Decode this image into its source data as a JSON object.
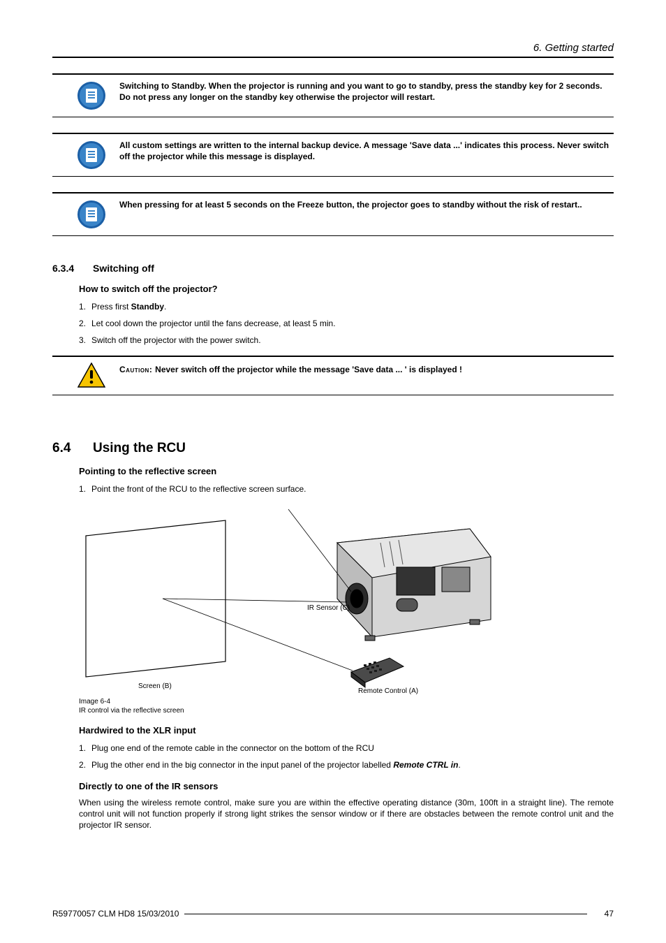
{
  "header": {
    "chapter_title": "6.  Getting started"
  },
  "notes": {
    "n1": "Switching to Standby.  When the projector is running and you want to go to standby, press the standby key for 2 seconds.  Do not press any longer on the standby key otherwise the projector will restart.",
    "n2": "All custom settings are written to the internal backup device.  A message 'Save data ...' indicates this process. Never switch off the projector while this message is displayed.",
    "n3": "When pressing for at least 5 seconds on the Freeze button, the projector goes to standby without the risk of restart.."
  },
  "sec634": {
    "num": "6.3.4",
    "title": "Switching off",
    "sub": "How to switch off the projector?",
    "step1_a": "Press first ",
    "step1_b": "Standby",
    "step1_c": ".",
    "step2": "Let cool down the projector until the fans decrease, at least 5 min.",
    "step3": "Switch off the projector with the power switch."
  },
  "caution": {
    "label": "Caution: ",
    "text": "Never switch off the projector while the message 'Save data ...  ' is displayed !"
  },
  "sec64": {
    "num": "6.4",
    "title": "Using the RCU",
    "subA": "Pointing to the reflective screen",
    "stepA1": "Point the front of the RCU to the reflective screen surface.",
    "subB": "Hardwired to the XLR input",
    "stepB1": "Plug one end of the remote cable in the connector on the bottom of the RCU",
    "stepB2_a": "Plug the other end in the big connector in the input panel of the projector labelled ",
    "stepB2_b": "Remote CTRL in",
    "stepB2_c": ".",
    "subC": "Directly to one of the IR sensors",
    "paraC": "When using the wireless remote control, make sure you are within the effective operating distance (30m, 100ft in a straight line).  The remote control unit will not function properly if strong light strikes the sensor window or if there are obstacles between the remote control unit and the projector IR sensor."
  },
  "figure": {
    "label_screen": "Screen (B)",
    "label_ir": "IR Sensor (C)",
    "label_remote": "Remote Control (A)",
    "caption_num": "Image 6-4",
    "caption_text": "IR control via the reflective screen"
  },
  "list_nums": {
    "n1": "1.",
    "n2": "2.",
    "n3": "3."
  },
  "footer": {
    "doc": "R59770057  CLM HD8  15/03/2010",
    "page": "47"
  }
}
